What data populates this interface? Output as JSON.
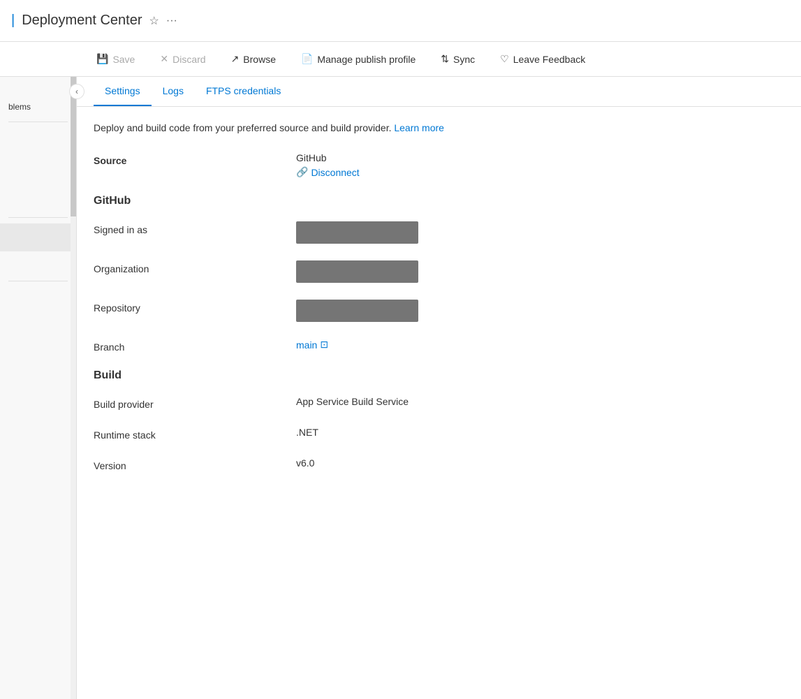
{
  "header": {
    "pipe": "|",
    "title": "Deployment Center",
    "star_icon": "☆",
    "more_icon": "···"
  },
  "toolbar": {
    "save_label": "Save",
    "discard_label": "Discard",
    "browse_label": "Browse",
    "manage_publish_label": "Manage publish profile",
    "sync_label": "Sync",
    "leave_feedback_label": "Leave Feedback"
  },
  "sidebar": {
    "collapse_icon": "‹",
    "problems_label": "blems",
    "divider1": "",
    "divider2": ""
  },
  "tabs": [
    {
      "label": "Settings",
      "active": true
    },
    {
      "label": "Logs",
      "active": false
    },
    {
      "label": "FTPS credentials",
      "active": false
    }
  ],
  "description": "Deploy and build code from your preferred source and build provider.",
  "learn_more": "Learn more",
  "sections": {
    "github": {
      "title": "GitHub",
      "source_label": "Source",
      "source_value": "GitHub",
      "disconnect_label": "Disconnect",
      "disconnect_icon": "🔗",
      "signed_in_label": "Signed in as",
      "organization_label": "Organization",
      "repository_label": "Repository",
      "branch_label": "Branch",
      "branch_value": "main",
      "branch_icon": "↗"
    },
    "build": {
      "title": "Build",
      "build_provider_label": "Build provider",
      "build_provider_value": "App Service Build Service",
      "runtime_stack_label": "Runtime stack",
      "runtime_stack_value": ".NET",
      "version_label": "Version",
      "version_value": "v6.0"
    }
  }
}
